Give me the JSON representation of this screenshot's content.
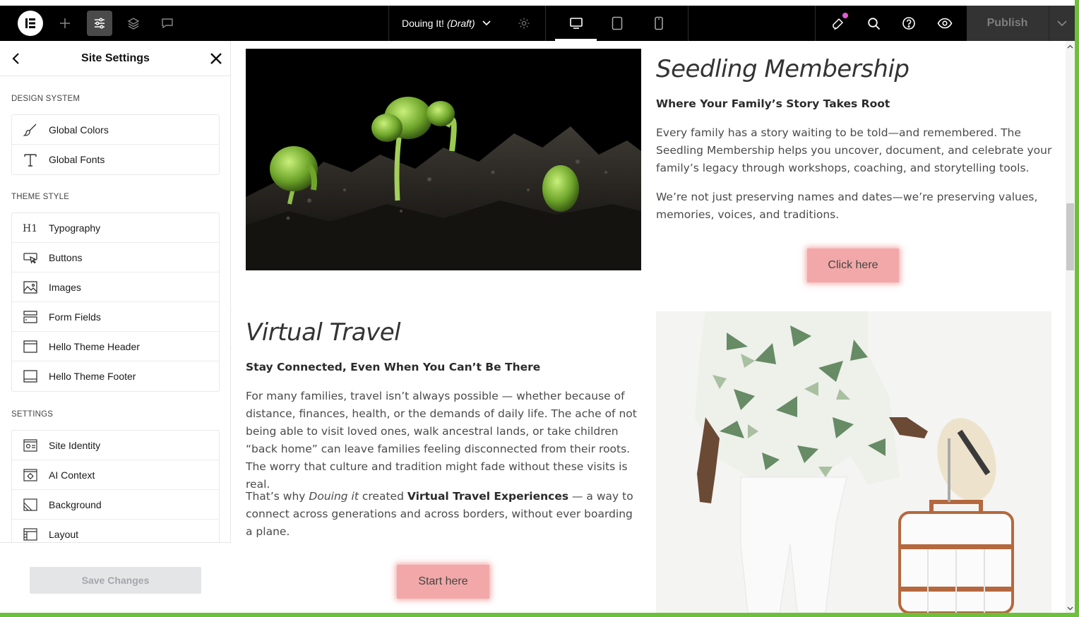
{
  "toolbar": {
    "doc_title": "Douing It!",
    "doc_status": "(Draft)",
    "publish_label": "Publish"
  },
  "panel": {
    "title": "Site Settings",
    "sections": [
      {
        "label": "DESIGN SYSTEM",
        "items": [
          {
            "label": "Global Colors",
            "icon": "brush-icon"
          },
          {
            "label": "Global Fonts",
            "icon": "type-icon"
          }
        ]
      },
      {
        "label": "THEME STYLE",
        "items": [
          {
            "label": "Typography",
            "icon": "heading-icon"
          },
          {
            "label": "Buttons",
            "icon": "button-cursor-icon"
          },
          {
            "label": "Images",
            "icon": "image-icon"
          },
          {
            "label": "Form Fields",
            "icon": "form-field-icon"
          },
          {
            "label": "Hello Theme Header",
            "icon": "header-layout-icon"
          },
          {
            "label": "Hello Theme Footer",
            "icon": "footer-layout-icon"
          }
        ]
      },
      {
        "label": "SETTINGS",
        "items": [
          {
            "label": "Site Identity",
            "icon": "site-identity-icon"
          },
          {
            "label": "AI Context",
            "icon": "ai-context-icon"
          },
          {
            "label": "Background",
            "icon": "background-icon"
          },
          {
            "label": "Layout",
            "icon": "layout-icon"
          }
        ]
      }
    ],
    "save_label": "Save Changes"
  },
  "canvas": {
    "seedling": {
      "title": "Seedling Membership",
      "subtitle": "Where Your Family’s Story Takes Root",
      "para1": "Every family has a story waiting to be told—and remembered. The Seedling Membership helps you uncover, document, and celebrate your family’s legacy through workshops, coaching, and storytelling tools.",
      "para2": "We’re not just preserving names and dates—we’re preserving values, memories, voices, and traditions.",
      "cta": "Click here"
    },
    "travel": {
      "title": "Virtual Travel",
      "subtitle": "Stay Connected, Even When You Can’t Be There",
      "para1": "For many families, travel isn’t always possible — whether because of distance, finances, health, or the demands of daily life. The ache of not being able to visit loved ones, walk ancestral lands, or take children “back home” can leave families feeling disconnected from their roots. The worry that culture and tradition might fade without these visits is real.",
      "para2_a": "That’s why ",
      "para2_b": "Douing it",
      "para2_c": " created ",
      "para2_d": "Virtual Travel Experiences",
      "para2_e": " — a way to connect across generations and across borders, without ever boarding a plane.",
      "cta": "Start here"
    }
  },
  "colors": {
    "toolbar_bg": "#000000",
    "cta_bg": "#f2a8a8",
    "frame_green": "#6cc13a",
    "notification_dot": "#e15bd6"
  }
}
